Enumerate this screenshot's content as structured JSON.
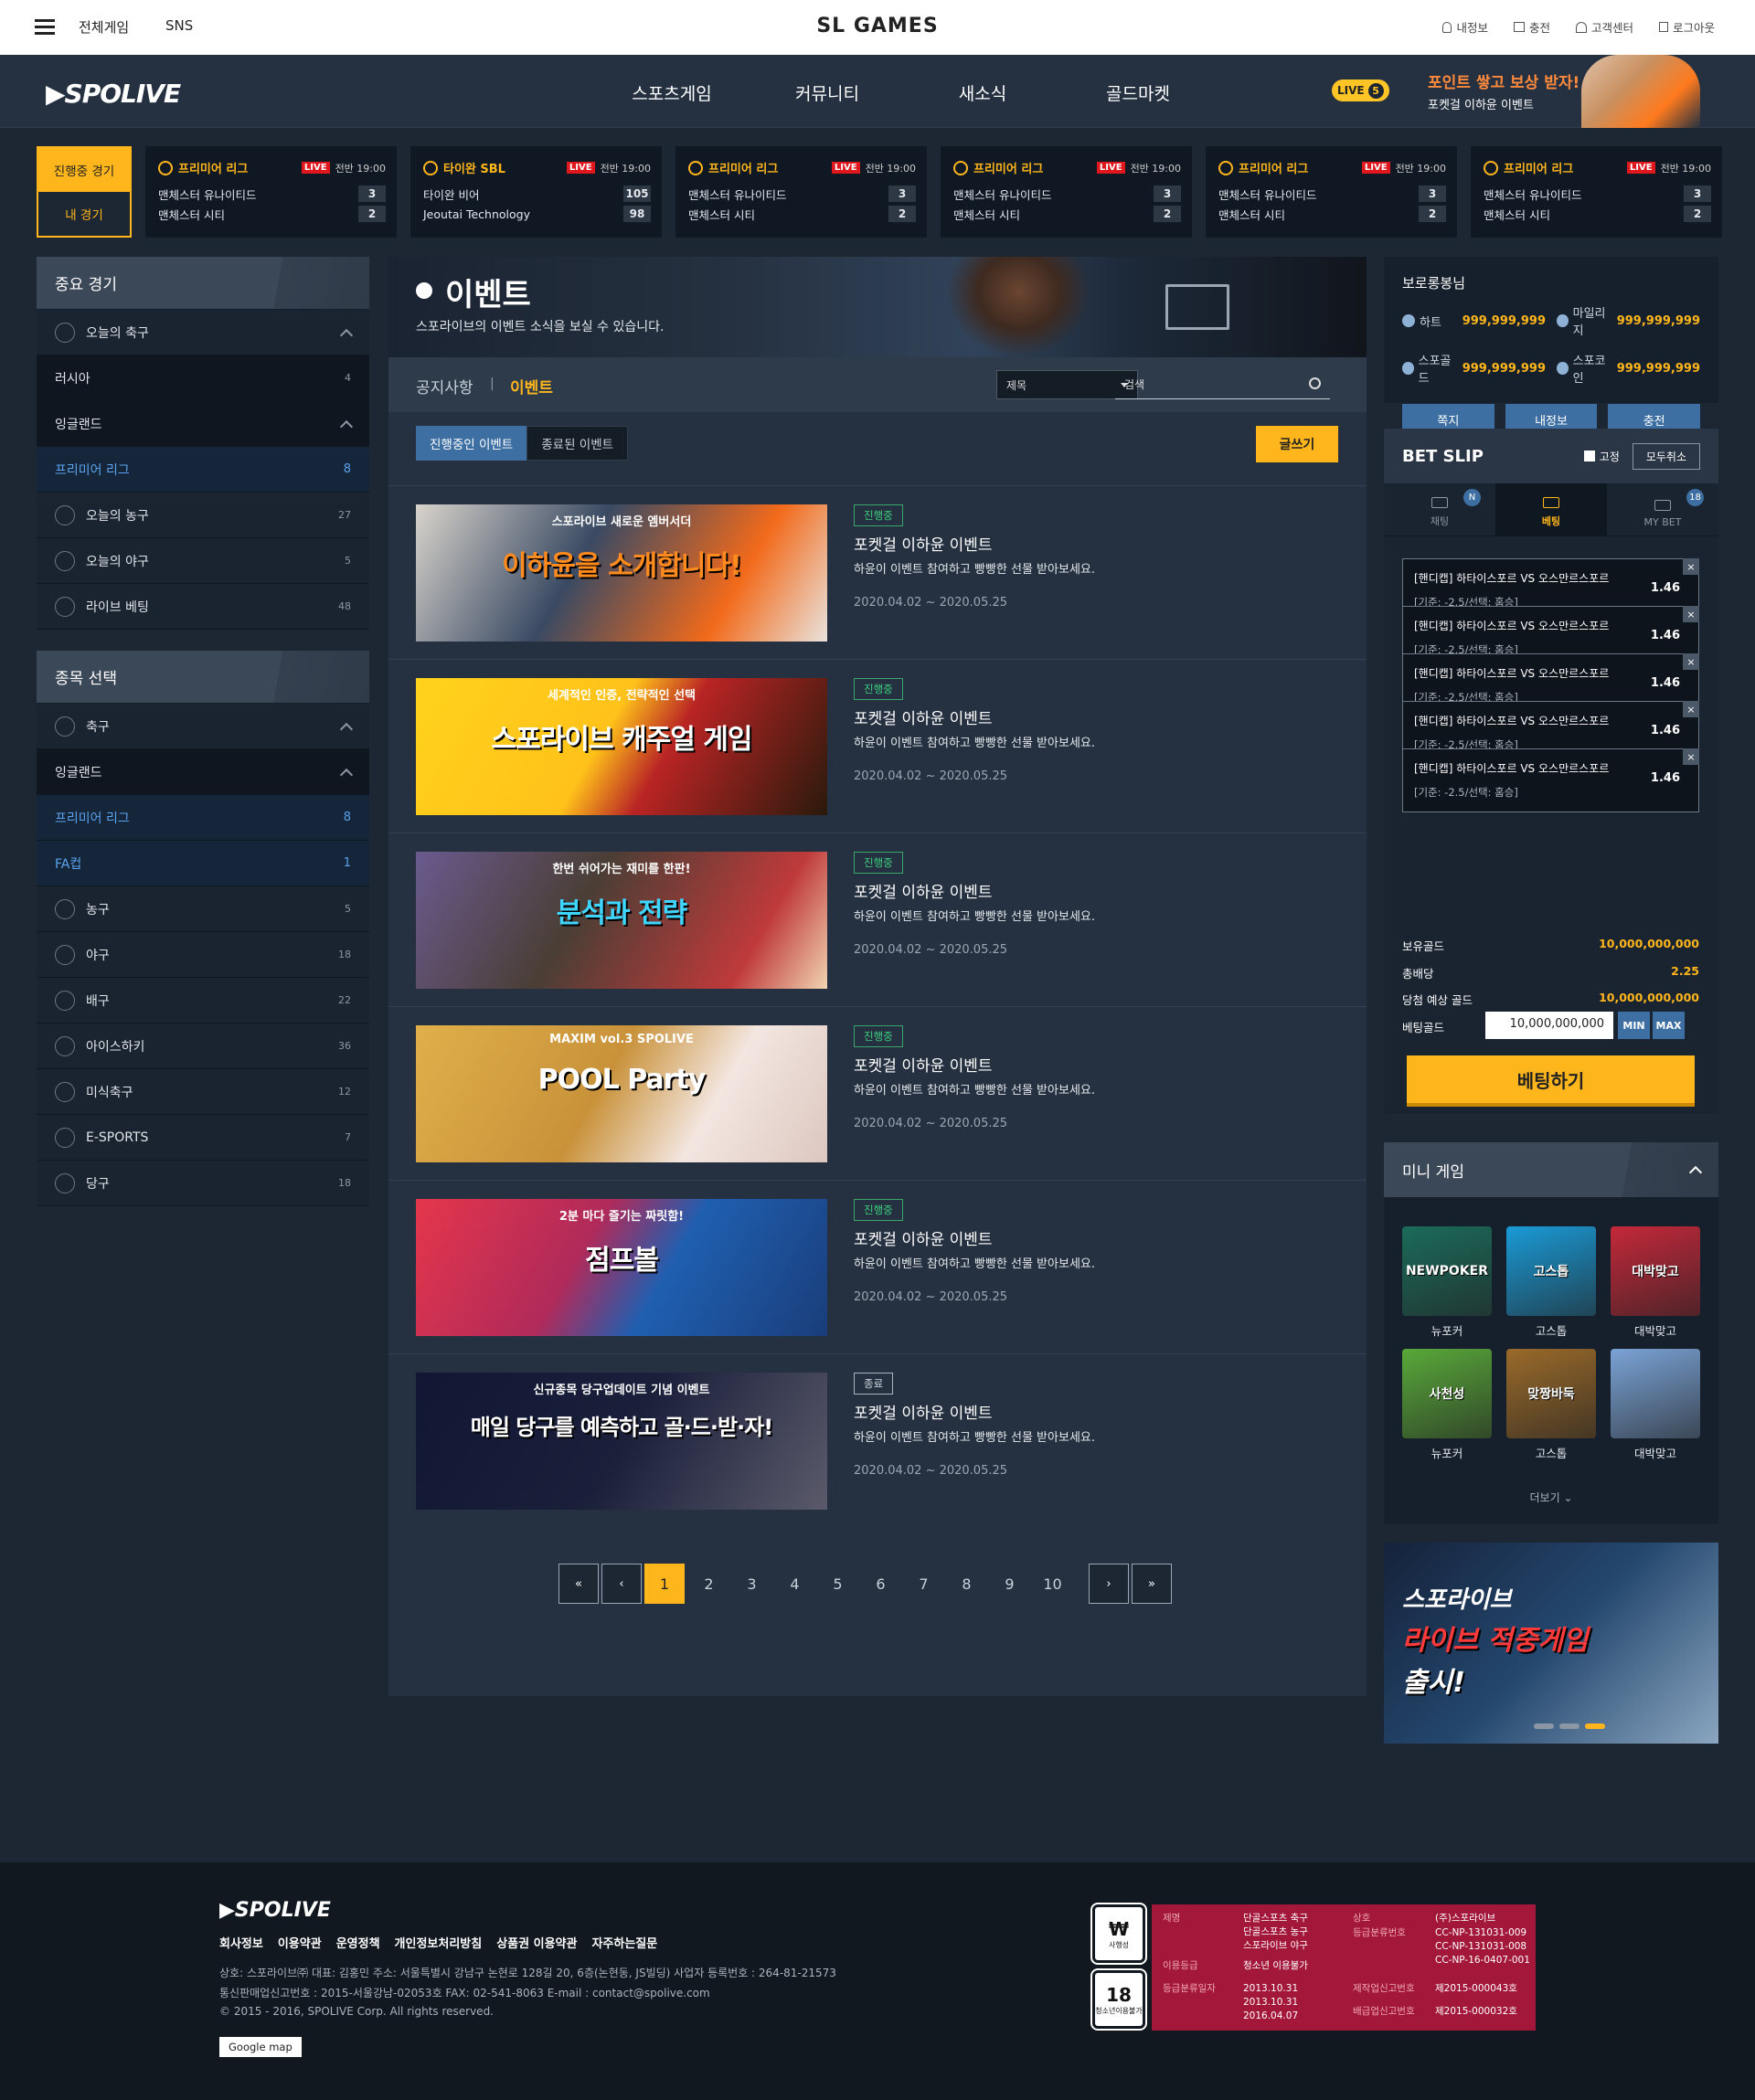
{
  "topbar": {
    "all_games": "전체게임",
    "sns": "SNS",
    "brand": "SL GAMES",
    "util": [
      "내정보",
      "충전",
      "고객센터",
      "로그아웃"
    ]
  },
  "gnb": {
    "logo": "SPOLIVE",
    "menu": [
      "스포츠게임",
      "커뮤니티",
      "새소식",
      "골드마켓"
    ],
    "live_label": "LIVE",
    "live_count": "5",
    "promo_title": "포인트 쌓고 보상 받자!",
    "promo_sub": "포켓걸 이하윤 이벤트"
  },
  "match_tabs": {
    "live": "진행중 경기",
    "mine": "내 경기"
  },
  "matches": [
    {
      "league": "프리미어 리그",
      "live": "LIVE",
      "time": "전반 19:00",
      "home": "맨체스터 유나이티드",
      "home_score": "3",
      "away": "맨체스터 시티",
      "away_score": "2"
    },
    {
      "league": "타이완 SBL",
      "live": "LIVE",
      "time": "전반 19:00",
      "home": "타이완 비어",
      "home_score": "105",
      "away": "Jeoutai Technology",
      "away_score": "98"
    },
    {
      "league": "프리미어 리그",
      "live": "LIVE",
      "time": "전반 19:00",
      "home": "맨체스터 유나이티드",
      "home_score": "3",
      "away": "맨체스터 시티",
      "away_score": "2"
    },
    {
      "league": "프리미어 리그",
      "live": "LIVE",
      "time": "전반 19:00",
      "home": "맨체스터 유나이티드",
      "home_score": "3",
      "away": "맨체스터 시티",
      "away_score": "2"
    },
    {
      "league": "프리미어 리그",
      "live": "LIVE",
      "time": "전반 19:00",
      "home": "맨체스터 유나이티드",
      "home_score": "3",
      "away": "맨체스터 시티",
      "away_score": "2"
    },
    {
      "league": "프리미어 리그",
      "live": "LIVE",
      "time": "전반 19:00",
      "home": "맨체스터 유나이티드",
      "home_score": "3",
      "away": "맨체스터 시티",
      "away_score": "2"
    }
  ],
  "important": {
    "title": "중요 경기",
    "items": [
      {
        "name": "오늘의 축구",
        "count": "",
        "type": "head",
        "icon": "soccer-ball-icon"
      },
      {
        "name": "러시아",
        "count": "4",
        "type": "dark"
      },
      {
        "name": "잉글랜드",
        "count": "",
        "type": "dark-head"
      },
      {
        "name": "프리미어 리그",
        "count": "8",
        "type": "sel"
      },
      {
        "name": "오늘의 농구",
        "count": "27",
        "type": "normal",
        "icon": "basketball-icon"
      },
      {
        "name": "오늘의 야구",
        "count": "5",
        "type": "normal",
        "icon": "baseball-icon"
      },
      {
        "name": "라이브 베팅",
        "count": "48",
        "type": "normal",
        "icon": "live-signal-icon"
      }
    ]
  },
  "sports": {
    "title": "종목 선택",
    "items": [
      {
        "name": "축구",
        "count": "",
        "type": "head",
        "icon": "soccer-ball-icon"
      },
      {
        "name": "잉글랜드",
        "count": "",
        "type": "dark-head"
      },
      {
        "name": "프리미어 리그",
        "count": "8",
        "type": "sel"
      },
      {
        "name": "FA컵",
        "count": "1",
        "type": "sel"
      },
      {
        "name": "농구",
        "count": "5",
        "type": "normal",
        "icon": "basketball-icon"
      },
      {
        "name": "야구",
        "count": "18",
        "type": "normal",
        "icon": "baseball-icon"
      },
      {
        "name": "배구",
        "count": "22",
        "type": "normal",
        "icon": "volleyball-icon"
      },
      {
        "name": "아이스하키",
        "count": "36",
        "type": "normal",
        "icon": "hockey-icon"
      },
      {
        "name": "미식축구",
        "count": "12",
        "type": "normal",
        "icon": "football-icon"
      },
      {
        "name": "E-SPORTS",
        "count": "7",
        "type": "normal",
        "icon": "esports-icon"
      },
      {
        "name": "당구",
        "count": "18",
        "type": "normal",
        "icon": "billiards-icon"
      }
    ]
  },
  "event_page": {
    "title": "이벤트",
    "subtitle": "스포라이브의 이벤트 소식을 보실 수 있습니다.",
    "tab_notice": "공지사항",
    "tab_event": "이벤트",
    "select_value": "제목",
    "search_placeholder": "검색",
    "sub_on": "진행중인 이벤트",
    "sub_off": "종료된 이벤트",
    "write": "글쓰기"
  },
  "events": [
    {
      "status": "진행중",
      "title": "포켓걸 이하윤 이벤트",
      "desc": "하윤이 이벤트 참여하고 빵빵한 선물 받아보세요.",
      "date": "2020.04.02 ~ 2020.05.25",
      "banner_top": "스포라이브 새로운 엠버서더",
      "banner_main": "이하윤을 소개합니다!",
      "color": "#ff7a1e"
    },
    {
      "status": "진행중",
      "title": "포켓걸 이하윤 이벤트",
      "desc": "하윤이 이벤트 참여하고 빵빵한 선물 받아보세요.",
      "date": "2020.04.02 ~ 2020.05.25",
      "banner_top": "세계적인 인증, 전략적인 선택",
      "banner_main": "스포라이브 캐주얼 게임",
      "color": "#ffc21a"
    },
    {
      "status": "진행중",
      "title": "포켓걸 이하윤 이벤트",
      "desc": "하윤이 이벤트 참여하고 빵빵한 선물 받아보세요.",
      "date": "2020.04.02 ~ 2020.05.25",
      "banner_top": "한번 쉬어가는 재미를 한판!",
      "banner_main": "분석과 전략",
      "color": "#5a4f44"
    },
    {
      "status": "진행중",
      "title": "포켓걸 이하윤 이벤트",
      "desc": "하윤이 이벤트 참여하고 빵빵한 선물 받아보세요.",
      "date": "2020.04.02 ~ 2020.05.25",
      "banner_top": "MAXIM vol.3 SPOLIVE",
      "banner_main": "POOL Party",
      "color": "#d6a23e"
    },
    {
      "status": "진행중",
      "title": "포켓걸 이하윤 이벤트",
      "desc": "하윤이 이벤트 참여하고 빵빵한 선물 받아보세요.",
      "date": "2020.04.02 ~ 2020.05.25",
      "banner_top": "2분 마다 즐기는 짜릿함!",
      "banner_main": "점프볼",
      "color": "#1f5fb0"
    },
    {
      "status": "종료",
      "title": "포켓걸 이하윤 이벤트",
      "desc": "하윤이 이벤트 참여하고 빵빵한 선물 받아보세요.",
      "date": "2020.04.02 ~ 2020.05.25",
      "banner_top": "신규종목 당구업데이트 기념 이벤트",
      "banner_main": "매일 당구를 예측하고 골·드·받·자!",
      "color": "#1a1f3a"
    }
  ],
  "pager": {
    "pages": [
      "1",
      "2",
      "3",
      "4",
      "5",
      "6",
      "7",
      "8",
      "9",
      "10"
    ],
    "current": "1"
  },
  "user": {
    "name": "보로롱봉님",
    "heart_label": "하트",
    "heart": "999,999,999",
    "mileage_label": "마일리지",
    "mileage": "999,999,999",
    "gold_label": "스포골드",
    "gold": "999,999,999",
    "coin_label": "스포코인",
    "coin": "999,999,999",
    "btn_msg": "쪽지",
    "btn_info": "내정보",
    "btn_charge": "충전"
  },
  "betslip": {
    "title": "BET SLIP",
    "fix": "고정",
    "clear": "모두취소",
    "tabs": [
      {
        "label": "채팅",
        "badge": "N"
      },
      {
        "label": "베팅",
        "badge": ""
      },
      {
        "label": "MY BET",
        "badge": "18"
      }
    ],
    "items": [
      {
        "match": "[핸디캡] 하타이스포르 VS 오스만르스포르",
        "detail": "[기준: -2.5/선택: 홈승]",
        "odds": "1.46"
      },
      {
        "match": "[핸디캡] 하타이스포르 VS 오스만르스포르",
        "detail": "[기준: -2.5/선택: 홈승]",
        "odds": "1.46"
      },
      {
        "match": "[핸디캡] 하타이스포르 VS 오스만르스포르",
        "detail": "[기준: -2.5/선택: 홈승]",
        "odds": "1.46"
      },
      {
        "match": "[핸디캡] 하타이스포르 VS 오스만르스포르",
        "detail": "[기준: -2.5/선택: 홈승]",
        "odds": "1.46"
      },
      {
        "match": "[핸디캡] 하타이스포르 VS 오스만르스포르",
        "detail": "[기준: -2.5/선택: 홈승]",
        "odds": "1.46"
      }
    ],
    "own_gold_label": "보유골드",
    "own_gold": "10,000,000,000",
    "total_odds_label": "총배당",
    "total_odds": "2.25",
    "expected_label": "당첨 예상 골드",
    "expected": "10,000,000,000",
    "bet_gold_label": "베팅골드",
    "bet_gold": "10,000,000,000",
    "min": "MIN",
    "max": "MAX",
    "bet_btn": "베팅하기"
  },
  "minigame": {
    "title": "미니 게임",
    "games": [
      {
        "name": "뉴포커",
        "art": "NEWPOKER",
        "color": "#1b6b5a"
      },
      {
        "name": "고스톱",
        "art": "고스톱",
        "color": "#1a9ad6"
      },
      {
        "name": "대박맞고",
        "art": "대박맞고",
        "color": "#c4283a"
      },
      {
        "name": "뉴포커",
        "art": "사천성",
        "color": "#59a93a"
      },
      {
        "name": "고스톱",
        "art": "맞짱바둑",
        "color": "#9a6a2a"
      },
      {
        "name": "대박맞고",
        "art": "",
        "color": "#7aa3d6"
      }
    ],
    "more": "더보기"
  },
  "promo": {
    "line1": "스포라이브",
    "line2": "라이브 적중게임",
    "line3": "출시!"
  },
  "footer": {
    "logo": "SPOLIVE",
    "links": [
      "회사정보",
      "이용약관",
      "운영정책",
      "개인정보처리방침",
      "상품권 이용약관",
      "자주하는질문"
    ],
    "info1": "상호: 스포라이브㈜   대표: 김홍민   주소: 서울특별시 강남구 논현로 128길 20, 6층(논현동, JS빌딩)   사업자 등록번호 : 264-81-21573",
    "info2": "통신판매업신고번호 : 2015-서울강남-02053호   FAX: 02-541-8063   E-mail : contact@spolive.com",
    "info3": "© 2015 - 2016, SPOLIVE Corp. All rights reserved.",
    "gmap": "Google map",
    "rating1": "₩",
    "rating1_sub": "사행성",
    "rating2": "18",
    "rating2_sub": "청소년이용불가",
    "grade": {
      "l1": "제명",
      "v1": "단골스포츠 축구\n단골스포츠 농구\n스포라이브 야구",
      "l2": "이용등급",
      "v2": "청소년 이용불가",
      "l3": "등급분류일자",
      "v3": "2013.10.31\n2013.10.31\n2016.04.07",
      "l4": "상호",
      "v4": "(주)스포라이브",
      "l5": "등급분류번호",
      "v5": "CC-NP-131031-009\nCC-NP-131031-008\nCC-NP-16-0407-001",
      "l6": "제작업신고번호",
      "v6": "제2015-000043호",
      "l7": "배급업신고번호",
      "v7": "제2015-000032호"
    }
  }
}
